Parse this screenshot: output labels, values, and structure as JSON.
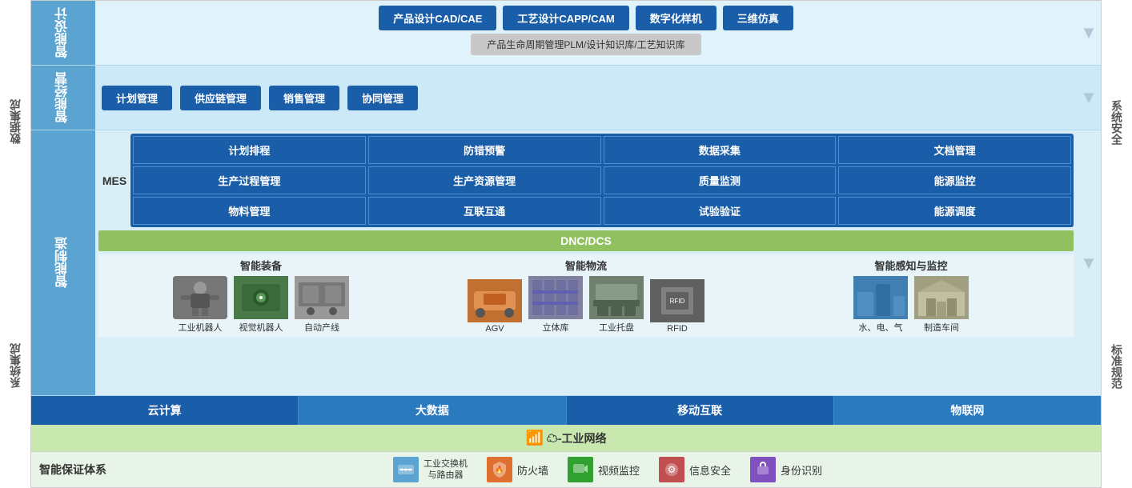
{
  "leftSidebar": {
    "top": "数据集成",
    "bottom": "系统集成"
  },
  "rightSidebar": {
    "top": "系统安全",
    "bottom": "标准规范"
  },
  "design": {
    "label": "智能设计",
    "buttons": [
      "产品设计CAD/CAE",
      "工艺设计CAPP/CAM",
      "数字化样机",
      "三维仿真"
    ],
    "plm": "产品生命周期管理PLM/设计知识库/工艺知识库"
  },
  "biz": {
    "label": "智能经营",
    "buttons": [
      "计划管理",
      "供应链管理",
      "销售管理",
      "协同管理"
    ]
  },
  "mfg": {
    "label": "智能制造",
    "mes": {
      "label": "MES",
      "cells": [
        "计划排程",
        "防错预警",
        "数据采集",
        "文档管理",
        "生产过程管理",
        "生产资源管理",
        "质量监测",
        "能源监控",
        "物料管理",
        "互联互通",
        "试验验证",
        "能源调度"
      ]
    },
    "dnc": "DNC/DCS",
    "equipGroups": [
      {
        "title": "智能装备",
        "items": [
          {
            "label": "工业机器人",
            "type": "robot"
          },
          {
            "label": "视觉机器人",
            "type": "machine"
          },
          {
            "label": "自动产线",
            "type": "cnc"
          }
        ]
      },
      {
        "title": "智能物流",
        "items": [
          {
            "label": "AGV",
            "type": "agv"
          },
          {
            "label": "立体库",
            "type": "warehouse"
          },
          {
            "label": "工业托盘",
            "type": "pallet"
          },
          {
            "label": "RFID",
            "type": "rfid"
          }
        ]
      },
      {
        "title": "智能感知与监控",
        "items": [
          {
            "label": "水、电、气",
            "type": "water"
          },
          {
            "label": "制造车间",
            "type": "factory"
          }
        ]
      }
    ]
  },
  "cloudRow": {
    "cells": [
      "云计算",
      "大数据",
      "移动互联",
      "物联网"
    ]
  },
  "network": {
    "label": "☁-工业网络"
  },
  "guarantee": {
    "title": "智能保证体系",
    "items": [
      {
        "icon": "✕",
        "label": "工业交换机\n与路由器",
        "iconType": "network"
      },
      {
        "icon": "🔥",
        "label": "防火墙",
        "iconType": "firewall"
      },
      {
        "icon": "📷",
        "label": "视频监控",
        "iconType": "video"
      },
      {
        "icon": "⚙",
        "label": "信息安全",
        "iconType": "security"
      },
      {
        "icon": "🔒",
        "label": "身份识别",
        "iconType": "id"
      }
    ]
  }
}
